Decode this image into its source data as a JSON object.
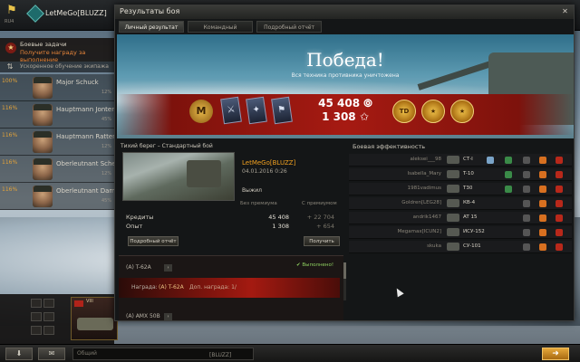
{
  "client": {
    "logo_label": "RU4",
    "player_name": "LetMeGo[BLUZZ]",
    "quests": {
      "title": "Боевые задачи",
      "subtitle": "Получите награду за выполнение"
    },
    "training": "Ускоренное обучение экипажа",
    "crew": [
      {
        "percent": "100%",
        "name": "Major Schuck",
        "skill": "12%"
      },
      {
        "percent": "116%",
        "name": "Hauptmann Jonter",
        "skill": "45%"
      },
      {
        "percent": "116%",
        "name": "Hauptmann Ratterbull",
        "skill": "12%"
      },
      {
        "percent": "116%",
        "name": "Oberleutnant Schermer",
        "skill": "12%"
      },
      {
        "percent": "116%",
        "name": "Oberleutnant Damon",
        "skill": "45%"
      }
    ],
    "tank_card_level": "VIII",
    "chat": {
      "placeholder": "Общий",
      "clan_tag": "[BLUZZ]"
    },
    "colors": {
      "accent": "#f0a020",
      "victory_band": "#a61a12",
      "positive": "#8ed060"
    }
  },
  "window": {
    "title": "Результаты боя",
    "close_glyph": "✕",
    "tabs": [
      {
        "label": "Личный результат",
        "active": true
      },
      {
        "label": "Командный результат",
        "active": false
      },
      {
        "label": "Подробный отчёт",
        "active": false
      }
    ]
  },
  "hero": {
    "result": "Победа!",
    "result_detail": "Вся техника противника уничтожена",
    "credits": "45 408",
    "xp": "1 308",
    "medal_letter": "M",
    "ribbon_labels": [
      "TD",
      "★",
      "★"
    ]
  },
  "battle": {
    "header": "Тихий берег – Стандартный бой",
    "player": "LetMeGo[BLUZZ]",
    "date": "04.01.2016 0:26",
    "status": "Выжил",
    "col_no_premium": "Без премиума",
    "col_premium": "С премиумом",
    "rows": [
      {
        "label": "Кредиты",
        "value": "45 408",
        "premium": "+ 22 704"
      },
      {
        "label": "Опыт",
        "value": "1 308",
        "premium": "+ 654"
      }
    ],
    "detail_button": "Подробный отчёт",
    "claim_button": "Получить"
  },
  "quest_panel": {
    "quests": [
      {
        "name": "(A) T-62A",
        "done": "✔ Выполнено!"
      },
      {
        "name": "(A) AMX 50B",
        "done": ""
      }
    ],
    "reward_label": "Награда:",
    "reward_value": "(A) T-62A",
    "reward_extra": "Доп. награда: 1/"
  },
  "efficiency": {
    "title": "Боевая эффективность",
    "rows": [
      {
        "name": "aleksei___98",
        "vehicle": "СТ-I"
      },
      {
        "name": "Isabella_Mary",
        "vehicle": "T-10"
      },
      {
        "name": "1981vadimus",
        "vehicle": "T30"
      },
      {
        "name": "Goldren[LEG28]",
        "vehicle": "КВ-4"
      },
      {
        "name": "andrik1467",
        "vehicle": "AT 15"
      },
      {
        "name": "Megamax[ICUN2]",
        "vehicle": "ИСУ-152"
      },
      {
        "name": "skuka",
        "vehicle": "СУ-101"
      }
    ]
  }
}
